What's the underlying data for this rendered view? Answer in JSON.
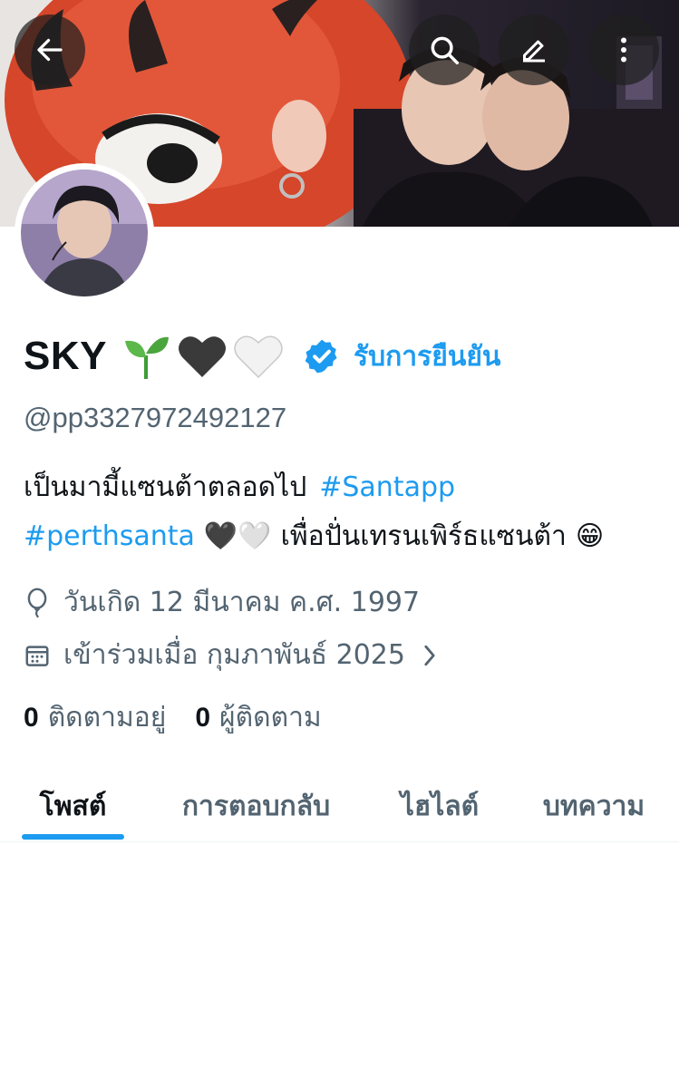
{
  "header": {
    "back_icon": "arrow-left-icon",
    "search_icon": "search-icon",
    "edit_icon": "pencil-icon",
    "more_icon": "more-vertical-icon"
  },
  "profile": {
    "display_name": "SKY",
    "name_emojis": [
      "🌱",
      "🖤",
      "🤍"
    ],
    "verify_label": "รับการยืนยัน",
    "handle": "@pp3327972492127",
    "bio": {
      "line1_text": "เป็นมามี้แซนต้าตลอดไป",
      "line1_hashtag": "#Santapp",
      "line2_hashtag": "#perthsanta",
      "line2_emojis": "🖤🤍",
      "line2_text": "เพื่อปั่นเทรนเพิร์ธแซนต้า",
      "line2_emoji_end": "😁"
    },
    "birthday": "วันเกิด 12 มีนาคม ค.ศ. 1997",
    "joined": "เข้าร่วมเมื่อ กุมภาพันธ์ 2025",
    "following_count": "0",
    "following_label": "ติดตามอยู่",
    "followers_count": "0",
    "followers_label": "ผู้ติดตาม"
  },
  "tabs": [
    {
      "label": "โพสต์",
      "active": true
    },
    {
      "label": "การตอบกลับ",
      "active": false
    },
    {
      "label": "ไฮไลต์",
      "active": false
    },
    {
      "label": "บทความ",
      "active": false
    }
  ],
  "colors": {
    "accent": "#1d9bf0",
    "text_primary": "#0f1419",
    "text_secondary": "#536471"
  }
}
